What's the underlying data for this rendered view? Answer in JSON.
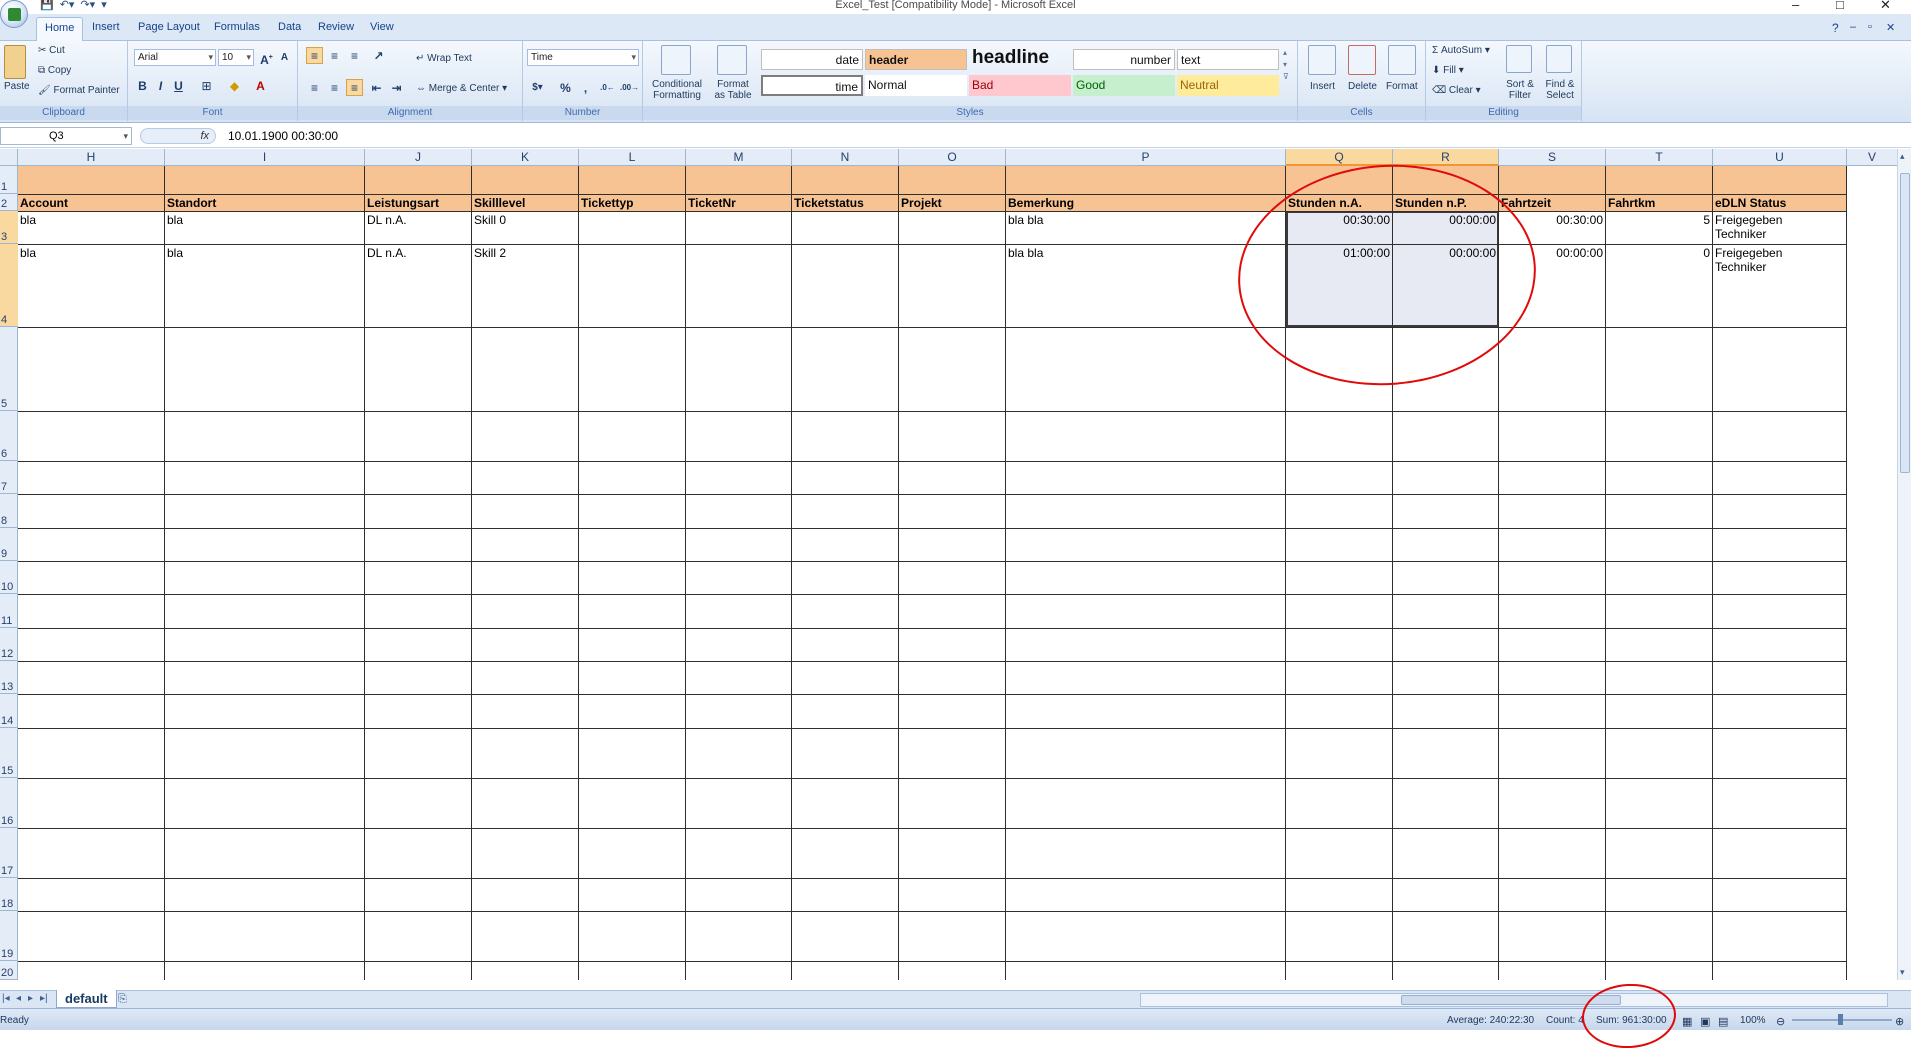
{
  "window": {
    "title": "Excel_Test  [Compatibility Mode] - Microsoft Excel",
    "controls": [
      "–",
      "□",
      "✕"
    ]
  },
  "tabs": [
    "Home",
    "Insert",
    "Page Layout",
    "Formulas",
    "Data",
    "Review",
    "View"
  ],
  "ribbon": {
    "clipboard": {
      "paste": "Paste",
      "cut": "Cut",
      "copy": "Copy",
      "format_painter": "Format Painter",
      "label": "Clipboard"
    },
    "font": {
      "name": "Arial",
      "size": "10",
      "bold": "B",
      "italic": "I",
      "underline": "U",
      "label": "Font"
    },
    "alignment": {
      "wrap": "Wrap Text",
      "merge": "Merge & Center",
      "label": "Alignment"
    },
    "number": {
      "format": "Time",
      "percent": "%",
      "comma": ",",
      "label": "Number"
    },
    "styles": {
      "conditional": "Conditional Formatting",
      "format_table": "Format as Table",
      "label": "Styles",
      "cells": {
        "date": "date",
        "header": "header",
        "headline": "headline",
        "number": "number",
        "text": "text",
        "time": "time",
        "normal": "Normal",
        "bad": "Bad",
        "good": "Good",
        "neutral": "Neutral"
      }
    },
    "cells": {
      "insert": "Insert",
      "delete": "Delete",
      "format": "Format",
      "label": "Cells"
    },
    "editing": {
      "autosum": "AutoSum",
      "fill": "Fill",
      "clear": "Clear",
      "sort": "Sort & Filter",
      "find": "Find & Select",
      "label": "Editing"
    }
  },
  "formula_bar": {
    "name_box": "Q3",
    "fx": "fx",
    "value": "10.01.1900  00:30:00"
  },
  "columns": [
    "H",
    "I",
    "J",
    "K",
    "L",
    "M",
    "N",
    "O",
    "P",
    "Q",
    "R",
    "S",
    "T",
    "U",
    "V"
  ],
  "rows": [
    "1",
    "2",
    "3",
    "4",
    "5",
    "6",
    "7",
    "8",
    "9",
    "10",
    "11",
    "12",
    "13",
    "14",
    "15",
    "16",
    "17",
    "18",
    "19",
    "20"
  ],
  "headers": [
    "Account",
    "Standort",
    "Leistungsart",
    "Skilllevel",
    "Tickettyp",
    "TicketNr",
    "Ticketstatus",
    "Projekt",
    "Bemerkung",
    "Stunden n.A.",
    "Stunden n.P.",
    "Fahrtzeit",
    "Fahrtkm",
    "eDLN Status"
  ],
  "data_rows": [
    {
      "account": "bla",
      "standort": "bla",
      "leistungsart": "DL n.A.",
      "skill": "Skill 0",
      "bemerkung": "bla bla",
      "stunden_na": "00:30:00",
      "stunden_np": "00:00:00",
      "fahrtzeit": "00:30:00",
      "fahrtkm": "5",
      "status1": "Freigegeben",
      "status2": "Techniker"
    },
    {
      "account": "bla",
      "standort": "bla",
      "leistungsart": "DL n.A.",
      "skill": "Skill 2",
      "bemerkung": "bla bla",
      "stunden_na": "01:00:00",
      "stunden_np": "00:00:00",
      "fahrtzeit": "00:00:00",
      "fahrtkm": "0",
      "status1": "Freigegeben",
      "status2": "Techniker"
    }
  ],
  "sheet_tab": "default",
  "status_bar": {
    "ready": "Ready",
    "average": "Average: 240:22:30",
    "count": "Count: 4",
    "sum": "Sum: 961:30:00",
    "zoom": "100%"
  },
  "colors": {
    "header_fill": "#f8c393",
    "selection": "#e7e9f3",
    "annotation": "#e10a0a"
  }
}
